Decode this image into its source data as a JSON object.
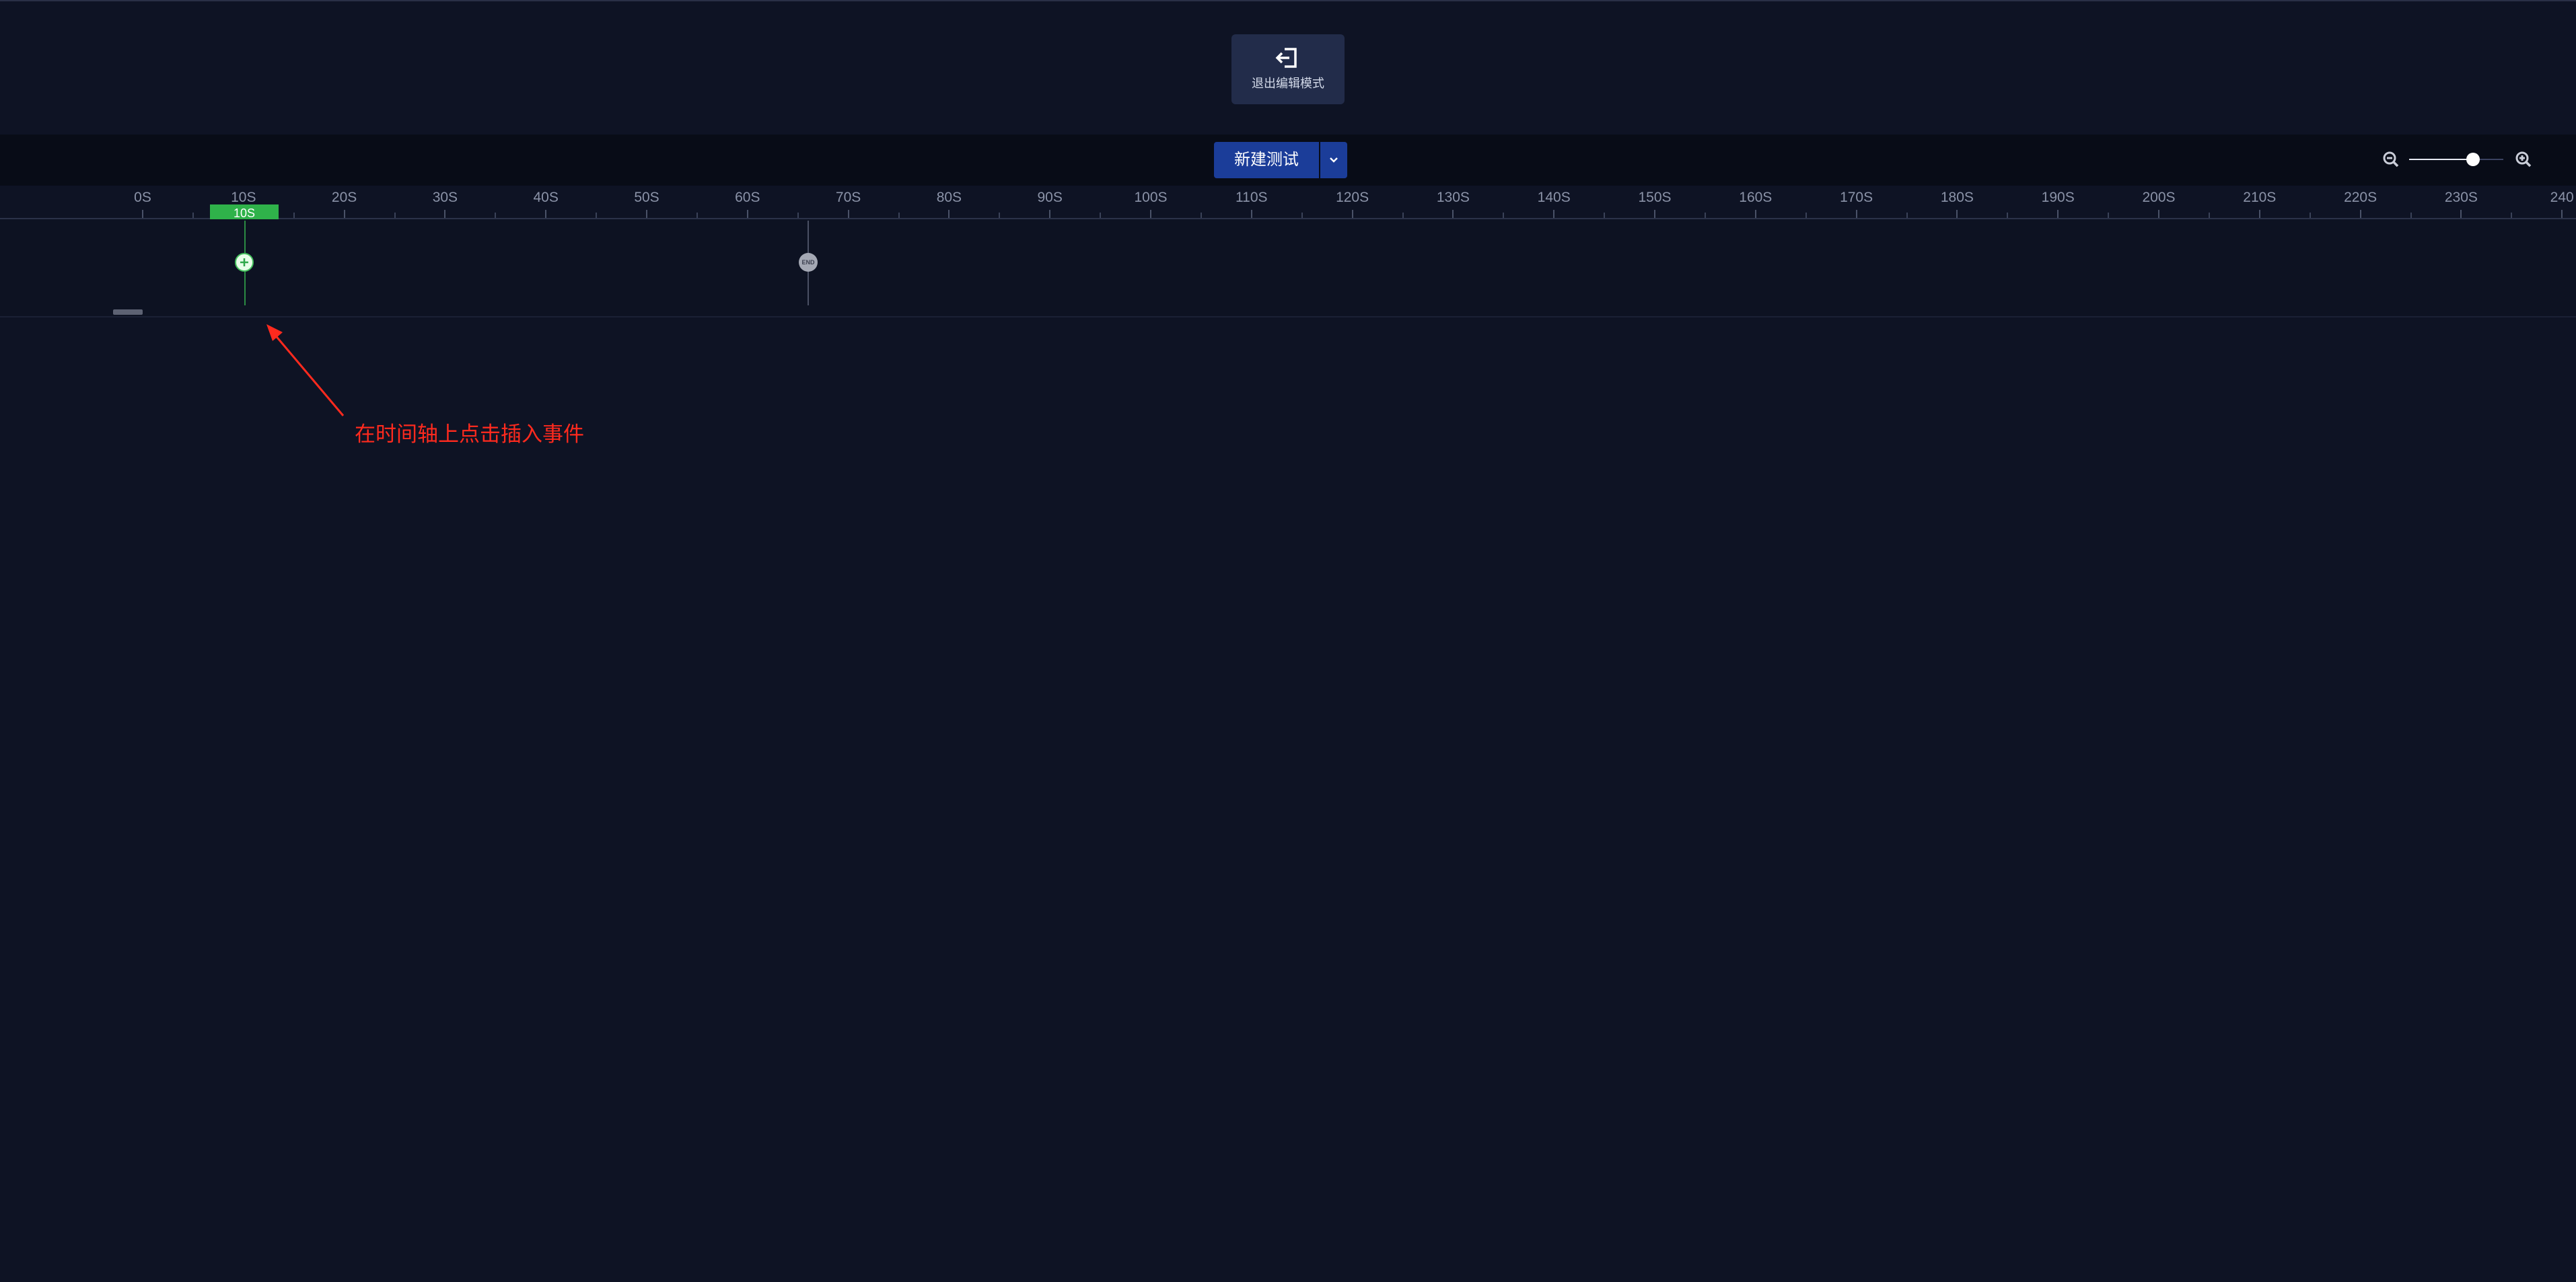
{
  "header": {
    "exit_button_label": "退出编辑模式",
    "exit_icon": "exit-icon"
  },
  "toolbar": {
    "new_test_label": "新建测试",
    "dropdown_icon": "chevron-down-icon",
    "zoom_out_icon": "zoom-out-icon",
    "zoom_in_icon": "zoom-in-icon",
    "zoom_level": 0.68
  },
  "timeline": {
    "ticks": [
      "0S",
      "10S",
      "20S",
      "30S",
      "40S",
      "50S",
      "60S",
      "70S",
      "80S",
      "90S",
      "100S",
      "110S",
      "120S",
      "130S",
      "140S",
      "150S",
      "160S",
      "170S",
      "180S",
      "190S",
      "200S",
      "210S",
      "220S",
      "230S",
      "240"
    ],
    "cursor_badge": "10S",
    "add_icon": "plus-icon",
    "end_label": "END"
  },
  "annotation": {
    "text": "在时间轴上点击插入事件"
  },
  "colors": {
    "background": "#0e1324",
    "toolbar": "#080c17",
    "primary_button": "#1b3d99",
    "cursor_green": "#2fb24a",
    "annotation_red": "#ff2a1e"
  }
}
